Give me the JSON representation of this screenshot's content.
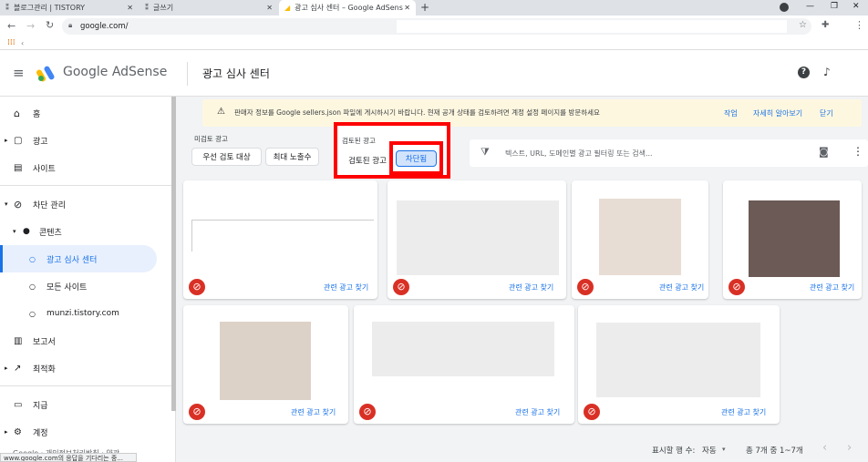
{
  "browser": {
    "tabs": [
      {
        "title": "블로그관리 | TISTORY"
      },
      {
        "title": "글쓰기"
      },
      {
        "title": "광고 심사 센터 – Google AdSens"
      }
    ],
    "address": "google.com/"
  },
  "app": {
    "product": "Google AdSense",
    "page_title": "광고 심사 센터"
  },
  "sidebar": {
    "items": [
      {
        "label": "홈",
        "icon": "home-icon"
      },
      {
        "label": "광고",
        "icon": "ads-icon"
      },
      {
        "label": "사이트",
        "icon": "site-icon"
      },
      {
        "label": "차단 관리",
        "icon": "block-icon"
      },
      {
        "label": "콘텐츠",
        "icon": "dot-icon"
      },
      {
        "label": "광고 심사 센터",
        "icon": "circle-icon"
      },
      {
        "label": "모든 사이트",
        "icon": "circle-icon"
      },
      {
        "label": "munzi.tistory.com",
        "icon": "dot-icon"
      },
      {
        "label": "보고서",
        "icon": "report-icon"
      },
      {
        "label": "최적화",
        "icon": "trend-icon"
      },
      {
        "label": "지급",
        "icon": "payment-icon"
      },
      {
        "label": "계정",
        "icon": "gear-icon"
      }
    ],
    "footer": "Google · 개인정보처리방침 · 약관",
    "status": "www.google.com의 응답을 기다리는 중..."
  },
  "banner": {
    "text": "판매자 정보를 Google sellers.json 파일에 게시하시기 바랍니다. 현재 공개 상태를 검토하려면 계정 설정 페이지를 방문하세요",
    "actions": [
      "작업",
      "자세히 알아보기",
      "닫기"
    ]
  },
  "filters": {
    "unreviewed_label": "미검토 광고",
    "unreviewed_chips": [
      "우선 검토 대상",
      "최대 노출수"
    ],
    "reviewed_label": "검토된 광고",
    "reviewed_chips": [
      "검토된 광고",
      "차단됨"
    ],
    "search_placeholder": "텍스트, URL, 도메인별 광고 필터링 또는 검색..."
  },
  "cards": {
    "link_label": "관련 광고 찾기"
  },
  "pagination": {
    "rows_label": "표시할 행 수:",
    "rows_value": "자동",
    "range": "총 7개 중 1~7개"
  },
  "colors": {
    "accent": "#1a73e8",
    "block_red": "#d93025",
    "banner_bg": "#fef7e0",
    "highlight": "#ff0000"
  }
}
